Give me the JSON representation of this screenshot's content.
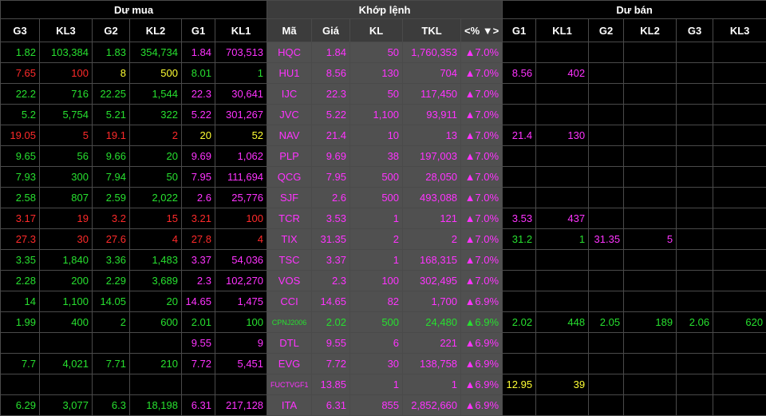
{
  "groups": {
    "buy": "Dư mua",
    "match": "Khớp lệnh",
    "sell": "Dư bán"
  },
  "headers": [
    "G3",
    "KL3",
    "G2",
    "KL2",
    "G1",
    "KL1",
    "Mã",
    "Giá",
    "KL",
    "TKL",
    "<% ▼>",
    "G1",
    "KL1",
    "G2",
    "KL2",
    "G3",
    "KL3"
  ],
  "colors": {
    "up": "#27e02f",
    "down": "#ff2a2a",
    "ref": "#ffff33",
    "ceiling": "#ff33ff",
    "mid_bg": "#505050"
  },
  "rows": [
    {
      "small": false,
      "cells": [
        [
          "1.82",
          "g"
        ],
        [
          "103,384",
          "g"
        ],
        [
          "1.83",
          "g"
        ],
        [
          "354,734",
          "g"
        ],
        [
          "1.84",
          "p"
        ],
        [
          "703,513",
          "p"
        ],
        [
          "HQC",
          "p"
        ],
        [
          "1.84",
          "p"
        ],
        [
          "50",
          "p"
        ],
        [
          "1,760,353",
          "p"
        ],
        [
          "▲7.0%",
          "p"
        ],
        [
          "",
          ""
        ],
        [
          "",
          ""
        ],
        [
          "",
          ""
        ],
        [
          "",
          ""
        ],
        [
          "",
          ""
        ],
        [
          "",
          ""
        ]
      ]
    },
    {
      "small": false,
      "cells": [
        [
          "7.65",
          "r"
        ],
        [
          "100",
          "r"
        ],
        [
          "8",
          "y"
        ],
        [
          "500",
          "y"
        ],
        [
          "8.01",
          "g"
        ],
        [
          "1",
          "g"
        ],
        [
          "HU1",
          "p"
        ],
        [
          "8.56",
          "p"
        ],
        [
          "130",
          "p"
        ],
        [
          "704",
          "p"
        ],
        [
          "▲7.0%",
          "p"
        ],
        [
          "8.56",
          "p"
        ],
        [
          "402",
          "p"
        ],
        [
          "",
          ""
        ],
        [
          "",
          ""
        ],
        [
          "",
          ""
        ],
        [
          "",
          ""
        ]
      ]
    },
    {
      "small": false,
      "cells": [
        [
          "22.2",
          "g"
        ],
        [
          "716",
          "g"
        ],
        [
          "22.25",
          "g"
        ],
        [
          "1,544",
          "g"
        ],
        [
          "22.3",
          "p"
        ],
        [
          "30,641",
          "p"
        ],
        [
          "IJC",
          "p"
        ],
        [
          "22.3",
          "p"
        ],
        [
          "50",
          "p"
        ],
        [
          "117,450",
          "p"
        ],
        [
          "▲7.0%",
          "p"
        ],
        [
          "",
          ""
        ],
        [
          "",
          ""
        ],
        [
          "",
          ""
        ],
        [
          "",
          ""
        ],
        [
          "",
          ""
        ],
        [
          "",
          ""
        ]
      ]
    },
    {
      "small": false,
      "cells": [
        [
          "5.2",
          "g"
        ],
        [
          "5,754",
          "g"
        ],
        [
          "5.21",
          "g"
        ],
        [
          "322",
          "g"
        ],
        [
          "5.22",
          "p"
        ],
        [
          "301,267",
          "p"
        ],
        [
          "JVC",
          "p"
        ],
        [
          "5.22",
          "p"
        ],
        [
          "1,100",
          "p"
        ],
        [
          "93,911",
          "p"
        ],
        [
          "▲7.0%",
          "p"
        ],
        [
          "",
          ""
        ],
        [
          "",
          ""
        ],
        [
          "",
          ""
        ],
        [
          "",
          ""
        ],
        [
          "",
          ""
        ],
        [
          "",
          ""
        ]
      ]
    },
    {
      "small": false,
      "cells": [
        [
          "19.05",
          "r"
        ],
        [
          "5",
          "r"
        ],
        [
          "19.1",
          "r"
        ],
        [
          "2",
          "r"
        ],
        [
          "20",
          "y"
        ],
        [
          "52",
          "y"
        ],
        [
          "NAV",
          "p"
        ],
        [
          "21.4",
          "p"
        ],
        [
          "10",
          "p"
        ],
        [
          "13",
          "p"
        ],
        [
          "▲7.0%",
          "p"
        ],
        [
          "21.4",
          "p"
        ],
        [
          "130",
          "p"
        ],
        [
          "",
          ""
        ],
        [
          "",
          ""
        ],
        [
          "",
          ""
        ],
        [
          "",
          ""
        ]
      ]
    },
    {
      "small": false,
      "cells": [
        [
          "9.65",
          "g"
        ],
        [
          "56",
          "g"
        ],
        [
          "9.66",
          "g"
        ],
        [
          "20",
          "g"
        ],
        [
          "9.69",
          "p"
        ],
        [
          "1,062",
          "p"
        ],
        [
          "PLP",
          "p"
        ],
        [
          "9.69",
          "p"
        ],
        [
          "38",
          "p"
        ],
        [
          "197,003",
          "p"
        ],
        [
          "▲7.0%",
          "p"
        ],
        [
          "",
          ""
        ],
        [
          "",
          ""
        ],
        [
          "",
          ""
        ],
        [
          "",
          ""
        ],
        [
          "",
          ""
        ],
        [
          "",
          ""
        ]
      ]
    },
    {
      "small": false,
      "cells": [
        [
          "7.93",
          "g"
        ],
        [
          "300",
          "g"
        ],
        [
          "7.94",
          "g"
        ],
        [
          "50",
          "g"
        ],
        [
          "7.95",
          "p"
        ],
        [
          "111,694",
          "p"
        ],
        [
          "QCG",
          "p"
        ],
        [
          "7.95",
          "p"
        ],
        [
          "500",
          "p"
        ],
        [
          "28,050",
          "p"
        ],
        [
          "▲7.0%",
          "p"
        ],
        [
          "",
          ""
        ],
        [
          "",
          ""
        ],
        [
          "",
          ""
        ],
        [
          "",
          ""
        ],
        [
          "",
          ""
        ],
        [
          "",
          ""
        ]
      ]
    },
    {
      "small": false,
      "cells": [
        [
          "2.58",
          "g"
        ],
        [
          "807",
          "g"
        ],
        [
          "2.59",
          "g"
        ],
        [
          "2,022",
          "g"
        ],
        [
          "2.6",
          "p"
        ],
        [
          "25,776",
          "p"
        ],
        [
          "SJF",
          "p"
        ],
        [
          "2.6",
          "p"
        ],
        [
          "500",
          "p"
        ],
        [
          "493,088",
          "p"
        ],
        [
          "▲7.0%",
          "p"
        ],
        [
          "",
          ""
        ],
        [
          "",
          ""
        ],
        [
          "",
          ""
        ],
        [
          "",
          ""
        ],
        [
          "",
          ""
        ],
        [
          "",
          ""
        ]
      ]
    },
    {
      "small": false,
      "cells": [
        [
          "3.17",
          "r"
        ],
        [
          "19",
          "r"
        ],
        [
          "3.2",
          "r"
        ],
        [
          "15",
          "r"
        ],
        [
          "3.21",
          "r"
        ],
        [
          "100",
          "r"
        ],
        [
          "TCR",
          "p"
        ],
        [
          "3.53",
          "p"
        ],
        [
          "1",
          "p"
        ],
        [
          "121",
          "p"
        ],
        [
          "▲7.0%",
          "p"
        ],
        [
          "3.53",
          "p"
        ],
        [
          "437",
          "p"
        ],
        [
          "",
          ""
        ],
        [
          "",
          ""
        ],
        [
          "",
          ""
        ],
        [
          "",
          ""
        ]
      ]
    },
    {
      "small": false,
      "cells": [
        [
          "27.3",
          "r"
        ],
        [
          "30",
          "r"
        ],
        [
          "27.6",
          "r"
        ],
        [
          "4",
          "r"
        ],
        [
          "27.8",
          "r"
        ],
        [
          "4",
          "r"
        ],
        [
          "TIX",
          "p"
        ],
        [
          "31.35",
          "p"
        ],
        [
          "2",
          "p"
        ],
        [
          "2",
          "p"
        ],
        [
          "▲7.0%",
          "p"
        ],
        [
          "31.2",
          "g"
        ],
        [
          "1",
          "g"
        ],
        [
          "31.35",
          "p"
        ],
        [
          "5",
          "p"
        ],
        [
          "",
          ""
        ],
        [
          "",
          ""
        ]
      ]
    },
    {
      "small": false,
      "cells": [
        [
          "3.35",
          "g"
        ],
        [
          "1,840",
          "g"
        ],
        [
          "3.36",
          "g"
        ],
        [
          "1,483",
          "g"
        ],
        [
          "3.37",
          "p"
        ],
        [
          "54,036",
          "p"
        ],
        [
          "TSC",
          "p"
        ],
        [
          "3.37",
          "p"
        ],
        [
          "1",
          "p"
        ],
        [
          "168,315",
          "p"
        ],
        [
          "▲7.0%",
          "p"
        ],
        [
          "",
          ""
        ],
        [
          "",
          ""
        ],
        [
          "",
          ""
        ],
        [
          "",
          ""
        ],
        [
          "",
          ""
        ],
        [
          "",
          ""
        ]
      ]
    },
    {
      "small": false,
      "cells": [
        [
          "2.28",
          "g"
        ],
        [
          "200",
          "g"
        ],
        [
          "2.29",
          "g"
        ],
        [
          "3,689",
          "g"
        ],
        [
          "2.3",
          "p"
        ],
        [
          "102,270",
          "p"
        ],
        [
          "VOS",
          "p"
        ],
        [
          "2.3",
          "p"
        ],
        [
          "100",
          "p"
        ],
        [
          "302,495",
          "p"
        ],
        [
          "▲7.0%",
          "p"
        ],
        [
          "",
          ""
        ],
        [
          "",
          ""
        ],
        [
          "",
          ""
        ],
        [
          "",
          ""
        ],
        [
          "",
          ""
        ],
        [
          "",
          ""
        ]
      ]
    },
    {
      "small": false,
      "cells": [
        [
          "14",
          "g"
        ],
        [
          "1,100",
          "g"
        ],
        [
          "14.05",
          "g"
        ],
        [
          "20",
          "g"
        ],
        [
          "14.65",
          "p"
        ],
        [
          "1,475",
          "p"
        ],
        [
          "CCI",
          "p"
        ],
        [
          "14.65",
          "p"
        ],
        [
          "82",
          "p"
        ],
        [
          "1,700",
          "p"
        ],
        [
          "▲6.9%",
          "p"
        ],
        [
          "",
          ""
        ],
        [
          "",
          ""
        ],
        [
          "",
          ""
        ],
        [
          "",
          ""
        ],
        [
          "",
          ""
        ],
        [
          "",
          ""
        ]
      ]
    },
    {
      "small": true,
      "cells": [
        [
          "1.99",
          "g"
        ],
        [
          "400",
          "g"
        ],
        [
          "2",
          "g"
        ],
        [
          "600",
          "g"
        ],
        [
          "2.01",
          "g"
        ],
        [
          "100",
          "g"
        ],
        [
          "CPNJ2006",
          "g"
        ],
        [
          "2.02",
          "g"
        ],
        [
          "500",
          "g"
        ],
        [
          "24,480",
          "g"
        ],
        [
          "▲6.9%",
          "g"
        ],
        [
          "2.02",
          "g"
        ],
        [
          "448",
          "g"
        ],
        [
          "2.05",
          "g"
        ],
        [
          "189",
          "g"
        ],
        [
          "2.06",
          "g"
        ],
        [
          "620",
          "g"
        ]
      ]
    },
    {
      "small": false,
      "cells": [
        [
          "",
          ""
        ],
        [
          "",
          ""
        ],
        [
          "",
          ""
        ],
        [
          "",
          ""
        ],
        [
          "9.55",
          "p"
        ],
        [
          "9",
          "p"
        ],
        [
          "DTL",
          "p"
        ],
        [
          "9.55",
          "p"
        ],
        [
          "6",
          "p"
        ],
        [
          "221",
          "p"
        ],
        [
          "▲6.9%",
          "p"
        ],
        [
          "",
          ""
        ],
        [
          "",
          ""
        ],
        [
          "",
          ""
        ],
        [
          "",
          ""
        ],
        [
          "",
          ""
        ],
        [
          "",
          ""
        ]
      ]
    },
    {
      "small": false,
      "cells": [
        [
          "7.7",
          "g"
        ],
        [
          "4,021",
          "g"
        ],
        [
          "7.71",
          "g"
        ],
        [
          "210",
          "g"
        ],
        [
          "7.72",
          "p"
        ],
        [
          "5,451",
          "p"
        ],
        [
          "EVG",
          "p"
        ],
        [
          "7.72",
          "p"
        ],
        [
          "30",
          "p"
        ],
        [
          "138,758",
          "p"
        ],
        [
          "▲6.9%",
          "p"
        ],
        [
          "",
          ""
        ],
        [
          "",
          ""
        ],
        [
          "",
          ""
        ],
        [
          "",
          ""
        ],
        [
          "",
          ""
        ],
        [
          "",
          ""
        ]
      ]
    },
    {
      "small": true,
      "cells": [
        [
          "",
          ""
        ],
        [
          "",
          ""
        ],
        [
          "",
          ""
        ],
        [
          "",
          ""
        ],
        [
          "",
          ""
        ],
        [
          "",
          ""
        ],
        [
          "FUCTVGF1",
          "p"
        ],
        [
          "13.85",
          "p"
        ],
        [
          "1",
          "p"
        ],
        [
          "1",
          "p"
        ],
        [
          "▲6.9%",
          "p"
        ],
        [
          "12.95",
          "y"
        ],
        [
          "39",
          "y"
        ],
        [
          "",
          ""
        ],
        [
          "",
          ""
        ],
        [
          "",
          ""
        ],
        [
          "",
          ""
        ]
      ]
    },
    {
      "small": false,
      "cells": [
        [
          "6.29",
          "g"
        ],
        [
          "3,077",
          "g"
        ],
        [
          "6.3",
          "g"
        ],
        [
          "18,198",
          "g"
        ],
        [
          "6.31",
          "p"
        ],
        [
          "217,128",
          "p"
        ],
        [
          "ITA",
          "p"
        ],
        [
          "6.31",
          "p"
        ],
        [
          "855",
          "p"
        ],
        [
          "2,852,660",
          "p"
        ],
        [
          "▲6.9%",
          "p"
        ],
        [
          "",
          ""
        ],
        [
          "",
          ""
        ],
        [
          "",
          ""
        ],
        [
          "",
          ""
        ],
        [
          "",
          ""
        ],
        [
          "",
          ""
        ]
      ]
    }
  ]
}
